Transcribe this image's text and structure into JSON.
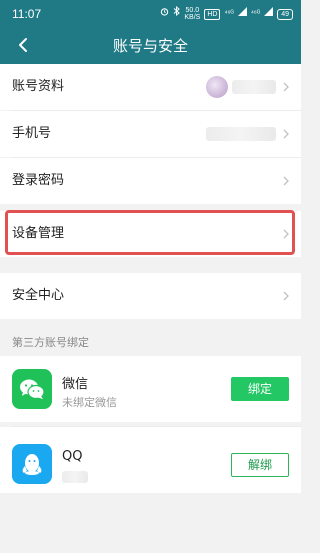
{
  "status_bar": {
    "time": "11:07",
    "net_speed_value": "50.0",
    "net_speed_unit": "KB/S",
    "hd_label": "HD",
    "signal_1": "⁴⁶ᴳ",
    "signal_2": "⁴⁶ᴳ",
    "battery": "49"
  },
  "nav": {
    "title": "账号与安全",
    "back_icon": "back-arrow-icon"
  },
  "settings": {
    "items": [
      {
        "label": "账号资料"
      },
      {
        "label": "手机号"
      },
      {
        "label": "登录密码"
      },
      {
        "label": "设备管理"
      },
      {
        "label": "安全中心"
      }
    ]
  },
  "third_party": {
    "section_title": "第三方账号绑定",
    "accounts": [
      {
        "name": "微信",
        "status": "未绑定微信",
        "button": "绑定",
        "icon": "wechat-icon"
      },
      {
        "name": "QQ",
        "status": "",
        "button": "解绑",
        "icon": "qq-icon"
      }
    ]
  },
  "colors": {
    "header": "#1f7a86",
    "highlight": "#e05252",
    "bind_button": "#23c865",
    "wechat": "#21c15a",
    "qq": "#1aa8f0"
  }
}
